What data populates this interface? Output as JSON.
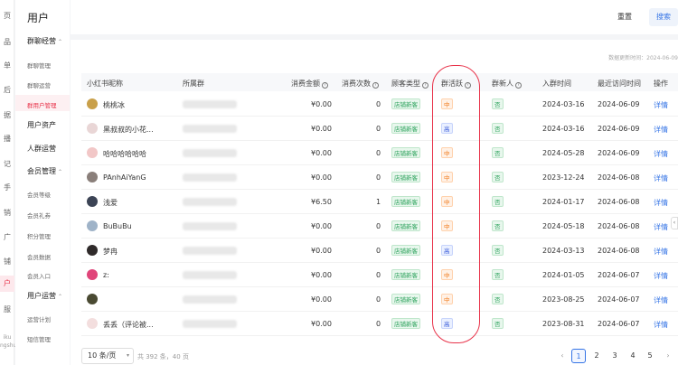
{
  "rail": {
    "items": [
      "页",
      "品",
      "单",
      "后",
      "据",
      "播",
      "记",
      "手",
      "销",
      "广",
      "铺",
      "户",
      "服"
    ],
    "footer": [
      "iku",
      "ngshu"
    ]
  },
  "sidebar": {
    "title": "用户",
    "groups": [
      {
        "label": "群聊经营",
        "chevron": "⌃"
      },
      {
        "label": "用户资产",
        "chevron": ""
      },
      {
        "label": "人群运营",
        "chevron": ""
      },
      {
        "label": "会员管理",
        "chevron": "⌃"
      },
      {
        "label": "用户运营",
        "chevron": "⌃"
      }
    ],
    "subs": [
      "群聊管理",
      "群聊运营",
      "群用户管理",
      "会员等级",
      "会员礼券",
      "积分管理",
      "会员数据",
      "会员入口",
      "运营计划",
      "短信管理"
    ]
  },
  "toolbar": {
    "reset_label": "重置",
    "search_label": "搜索"
  },
  "updated_text": "数据更新时间：2024-06-09",
  "table": {
    "headers": [
      "小红书昵称",
      "所属群",
      "消费金额",
      "消费次数",
      "顾客类型",
      "群活跃",
      "群新人",
      "入群时间",
      "最近访问时间",
      "操作"
    ],
    "rows": [
      {
        "nick": "桃桃冰",
        "amount": "¥0.00",
        "count": "0",
        "type": "店铺新客",
        "active": "中",
        "new": "否",
        "joined": "2024-03-16",
        "visited": "2024-06-09",
        "op": "详情",
        "avatar": "#c9a04a"
      },
      {
        "nick": "黑叔叔的小花...",
        "amount": "¥0.00",
        "count": "0",
        "type": "店铺新客",
        "active": "高",
        "new": "否",
        "joined": "2024-03-16",
        "visited": "2024-06-09",
        "op": "详情",
        "avatar": "#e9d6d6"
      },
      {
        "nick": "哈哈哈哈哈哈",
        "amount": "¥0.00",
        "count": "0",
        "type": "店铺新客",
        "active": "中",
        "new": "否",
        "joined": "2024-05-28",
        "visited": "2024-06-09",
        "op": "详情",
        "avatar": "#f2c7c7"
      },
      {
        "nick": "PAnhAiYanG",
        "amount": "¥0.00",
        "count": "0",
        "type": "店铺新客",
        "active": "中",
        "new": "否",
        "joined": "2023-12-24",
        "visited": "2024-06-08",
        "op": "详情",
        "avatar": "#8a7f7a"
      },
      {
        "nick": "浅爱",
        "amount": "¥6.50",
        "count": "1",
        "type": "店铺新客",
        "active": "中",
        "new": "否",
        "joined": "2024-01-17",
        "visited": "2024-06-08",
        "op": "详情",
        "avatar": "#3c4455"
      },
      {
        "nick": "BuBuBu",
        "amount": "¥0.00",
        "count": "0",
        "type": "店铺新客",
        "active": "中",
        "new": "否",
        "joined": "2024-05-18",
        "visited": "2024-06-08",
        "op": "详情",
        "avatar": "#9fb3c8"
      },
      {
        "nick": "梦冉",
        "amount": "¥0.00",
        "count": "0",
        "type": "店铺新客",
        "active": "高",
        "new": "否",
        "joined": "2024-03-13",
        "visited": "2024-06-08",
        "op": "详情",
        "avatar": "#2f2a2a"
      },
      {
        "nick": "z:",
        "amount": "¥0.00",
        "count": "0",
        "type": "店铺新客",
        "active": "中",
        "new": "否",
        "joined": "2024-01-05",
        "visited": "2024-06-07",
        "op": "详情",
        "avatar": "#e0457a"
      },
      {
        "nick": "",
        "amount": "¥0.00",
        "count": "0",
        "type": "店铺新客",
        "active": "中",
        "new": "否",
        "joined": "2023-08-25",
        "visited": "2024-06-07",
        "op": "详情",
        "avatar": "#4a4a32"
      },
      {
        "nick": "丢丢（评论被...",
        "amount": "¥0.00",
        "count": "0",
        "type": "店铺新客",
        "active": "高",
        "new": "否",
        "joined": "2023-08-31",
        "visited": "2024-06-07",
        "op": "详情",
        "avatar": "#f3dede"
      }
    ]
  },
  "pagination": {
    "page_size": "10 条/页",
    "total": "共 392 条，40 页",
    "pages": [
      "1",
      "2",
      "3",
      "4",
      "5"
    ],
    "current": "1",
    "prev": "‹",
    "next": "›"
  },
  "colors": {
    "accent": "#e8334a",
    "link": "#3574e6",
    "tag_green": "#2aa15a",
    "tag_orange": "#f07a1a",
    "tag_blue": "#3a5bd9"
  }
}
